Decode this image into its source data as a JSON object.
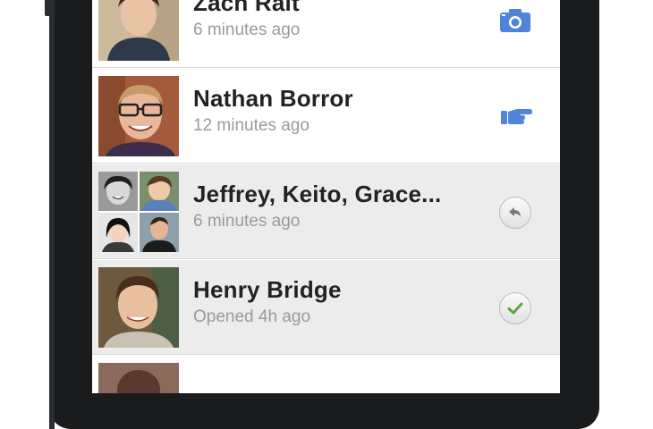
{
  "conversations": [
    {
      "name": "Zach Rait",
      "subtitle": "6 minutes ago",
      "status_icon": "camera-icon",
      "read": false
    },
    {
      "name": "Nathan Borror",
      "subtitle": "12 minutes ago",
      "status_icon": "pointing-hand-icon",
      "read": false
    },
    {
      "name": "Jeffrey, Keito, Grace...",
      "subtitle": "6 minutes ago",
      "status_icon": "reply-arrow-icon",
      "read": true
    },
    {
      "name": "Henry Bridge",
      "subtitle": "Opened 4h ago",
      "status_icon": "checkmark-icon",
      "read": true
    }
  ],
  "colors": {
    "accent_blue": "#4f84d8",
    "check_green": "#5aa646",
    "read_row_bg": "#ececec",
    "subtitle_gray": "#9a9a9a"
  }
}
